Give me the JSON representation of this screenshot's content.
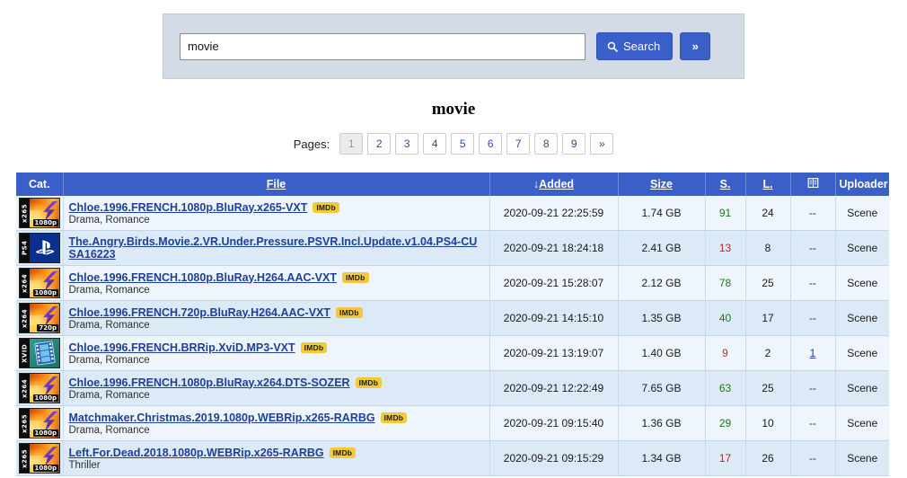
{
  "search": {
    "value": "movie",
    "placeholder": "",
    "search_label": "Search",
    "advanced_label": "»",
    "search_icon": "magnifier-icon"
  },
  "page_title": "movie",
  "pagination": {
    "label": "Pages:",
    "pages": [
      "1",
      "2",
      "3",
      "4",
      "5",
      "6",
      "7",
      "8",
      "9",
      "»"
    ],
    "active_index": 0
  },
  "table": {
    "headers": {
      "cat": "Cat.",
      "file": "File",
      "added": "Added",
      "added_sort_arrow": "↓",
      "size": "Size",
      "seeders": "S.",
      "leechers": "L.",
      "comments_icon": "comments-icon",
      "uploader": "Uploader"
    },
    "rows": [
      {
        "cat": {
          "codec": "x265",
          "res": "1080p",
          "art": "flame"
        },
        "name": "Chloe.1996.FRENCH.1080p.BluRay.x265-VXT",
        "badge": "IMDb",
        "genre": "Drama, Romance",
        "added": "2020-09-21 22:25:59",
        "size": "1.74 GB",
        "seeders": "91",
        "seeders_level": "high",
        "leechers": "24",
        "comments": "--",
        "comments_link": false,
        "uploader": "Scene"
      },
      {
        "cat": {
          "codec": "PS4",
          "res": "",
          "art": "ps4"
        },
        "name": "The.Angry.Birds.Movie.2.VR.Under.Pressure.PSVR.Incl.Update.v1.04.PS4-CUSA16223",
        "badge": "",
        "genre": "",
        "added": "2020-09-21 18:24:18",
        "size": "2.41 GB",
        "seeders": "13",
        "seeders_level": "low",
        "leechers": "8",
        "comments": "--",
        "comments_link": false,
        "uploader": "Scene"
      },
      {
        "cat": {
          "codec": "x264",
          "res": "1080p",
          "art": "flame"
        },
        "name": "Chloe.1996.FRENCH.1080p.BluRay.H264.AAC-VXT",
        "badge": "IMDb",
        "genre": "Drama, Romance",
        "added": "2020-09-21 15:28:07",
        "size": "2.12 GB",
        "seeders": "78",
        "seeders_level": "high",
        "leechers": "25",
        "comments": "--",
        "comments_link": false,
        "uploader": "Scene"
      },
      {
        "cat": {
          "codec": "x264",
          "res": "720p",
          "art": "flame"
        },
        "name": "Chloe.1996.FRENCH.720p.BluRay.H264.AAC-VXT",
        "badge": "IMDb",
        "genre": "Drama, Romance",
        "added": "2020-09-21 14:15:10",
        "size": "1.35 GB",
        "seeders": "40",
        "seeders_level": "high",
        "leechers": "17",
        "comments": "--",
        "comments_link": false,
        "uploader": "Scene"
      },
      {
        "cat": {
          "codec": "XVID",
          "res": "",
          "art": "xvid"
        },
        "name": "Chloe.1996.FRENCH.BRRip.XviD.MP3-VXT",
        "badge": "IMDb",
        "genre": "Drama, Romance",
        "added": "2020-09-21 13:19:07",
        "size": "1.40 GB",
        "seeders": "9",
        "seeders_level": "low",
        "leechers": "2",
        "comments": "1",
        "comments_link": true,
        "uploader": "Scene"
      },
      {
        "cat": {
          "codec": "x264",
          "res": "1080p",
          "art": "flame"
        },
        "name": "Chloe.1996.FRENCH.1080p.BluRay.x264.DTS-SOZER",
        "badge": "IMDb",
        "genre": "Drama, Romance",
        "added": "2020-09-21 12:22:49",
        "size": "7.65 GB",
        "seeders": "63",
        "seeders_level": "high",
        "leechers": "25",
        "comments": "--",
        "comments_link": false,
        "uploader": "Scene"
      },
      {
        "cat": {
          "codec": "x265",
          "res": "1080p",
          "art": "flame"
        },
        "name": "Matchmaker.Christmas.2019.1080p.WEBRip.x265-RARBG",
        "badge": "IMDb",
        "genre": "Drama, Romance",
        "added": "2020-09-21 09:15:40",
        "size": "1.36 GB",
        "seeders": "29",
        "seeders_level": "high",
        "leechers": "10",
        "comments": "--",
        "comments_link": false,
        "uploader": "Scene"
      },
      {
        "cat": {
          "codec": "x265",
          "res": "1080p",
          "art": "flame"
        },
        "name": "Left.For.Dead.2018.1080p.WEBRip.x265-RARBG",
        "badge": "IMDb",
        "genre": "Thriller",
        "added": "2020-09-21 09:15:29",
        "size": "1.34 GB",
        "seeders": "17",
        "seeders_level": "low",
        "leechers": "26",
        "comments": "--",
        "comments_link": false,
        "uploader": "Scene"
      }
    ]
  },
  "colors": {
    "header_blue": "#3a5fc8",
    "panel_gray": "#d3dce6",
    "row_odd": "#eef5fc",
    "row_even": "#dce9f7",
    "link_blue": "#1f3f99",
    "seed_high": "#1a7a1a",
    "seed_low": "#a33030",
    "imdb_yellow": "#f2c938"
  }
}
